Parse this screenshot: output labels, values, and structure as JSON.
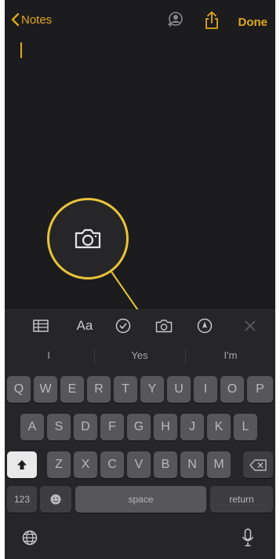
{
  "nav": {
    "back_label": "Notes",
    "done_label": "Done"
  },
  "toolbar": {
    "format_label": "Aa"
  },
  "suggestions": [
    "I",
    "Yes",
    "I'm"
  ],
  "keyboard": {
    "row1": [
      "Q",
      "W",
      "E",
      "R",
      "T",
      "Y",
      "U",
      "I",
      "O",
      "P"
    ],
    "row2": [
      "A",
      "S",
      "D",
      "F",
      "G",
      "H",
      "J",
      "K",
      "L"
    ],
    "row3": [
      "Z",
      "X",
      "C",
      "V",
      "B",
      "N",
      "M"
    ],
    "numbers_label": "123",
    "space_label": "space",
    "return_label": "return"
  },
  "colors": {
    "accent": "#e0a81a",
    "highlight": "#e8c33a",
    "background": "#1c1c1e",
    "keyboard": "#262628"
  },
  "icons": [
    "chevron-left-icon",
    "collaborate-icon",
    "share-icon",
    "table-icon",
    "checklist-icon",
    "camera-icon",
    "markup-icon",
    "close-icon",
    "shift-icon",
    "emoji-icon",
    "delete-icon",
    "globe-icon",
    "microphone-icon"
  ]
}
